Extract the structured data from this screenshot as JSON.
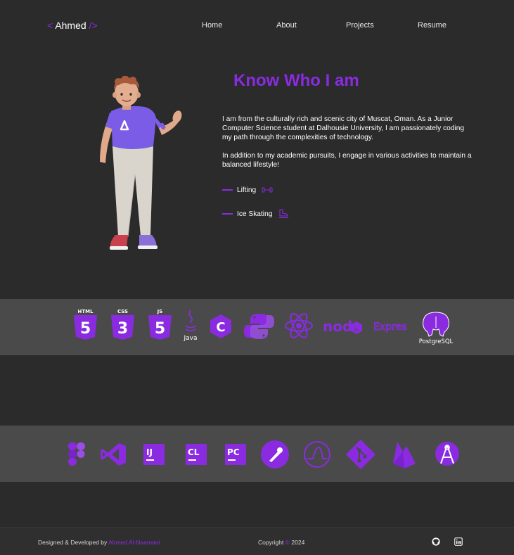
{
  "nav": {
    "logo": {
      "open": "<",
      "name": "Ahmed",
      "close": "/>"
    },
    "links": [
      "Home",
      "About",
      "Projects",
      "Resume"
    ]
  },
  "about": {
    "heading": "Know Who I am",
    "paragraph1": "I am from the culturally rich and scenic city of Muscat, Oman. As a Junior Computer Science student at Dalhousie University, I am passionately coding my path through the complexities of technology.",
    "paragraph2": "In addition to my academic pursuits, I engage in various activities to maintain a balanced lifestyle!",
    "hobbies": [
      {
        "label": "Lifting",
        "icon": "dumbbell-icon"
      },
      {
        "label": "Ice Skating",
        "icon": "ice-skate-icon"
      }
    ]
  },
  "skills": {
    "languages": [
      {
        "name": "html5-icon",
        "text": "HTML"
      },
      {
        "name": "css3-icon",
        "text": "CSS"
      },
      {
        "name": "javascript-icon",
        "text": "JS"
      },
      {
        "name": "java-icon",
        "text": "Java"
      },
      {
        "name": "c-icon",
        "text": "C"
      },
      {
        "name": "python-icon"
      },
      {
        "name": "react-icon"
      },
      {
        "name": "nodejs-icon",
        "text": "node"
      },
      {
        "name": "express-icon",
        "text": "Express"
      },
      {
        "name": "postgresql-icon",
        "text": "PostgreSQL"
      }
    ],
    "tools": [
      {
        "name": "figma-icon"
      },
      {
        "name": "visual-studio-icon"
      },
      {
        "name": "intellij-icon",
        "text": "IJ"
      },
      {
        "name": "clion-icon",
        "text": "CL"
      },
      {
        "name": "pycharm-icon",
        "text": "PC"
      },
      {
        "name": "postman-icon"
      },
      {
        "name": "grafana-icon"
      },
      {
        "name": "git-icon"
      },
      {
        "name": "firebase-icon"
      },
      {
        "name": "android-studio-icon"
      }
    ]
  },
  "footer": {
    "designed_prefix": "Designed & Developed by",
    "author": "Ahmed Al-Naamani",
    "copyright_prefix": "Copyright",
    "copyright_symbol": "©",
    "year": "2024",
    "socials": [
      "github-icon",
      "linkedin-icon"
    ]
  },
  "colors": {
    "accent": "#8a2be2",
    "background": "#2b2b2b",
    "band": "#4a4a4a"
  }
}
